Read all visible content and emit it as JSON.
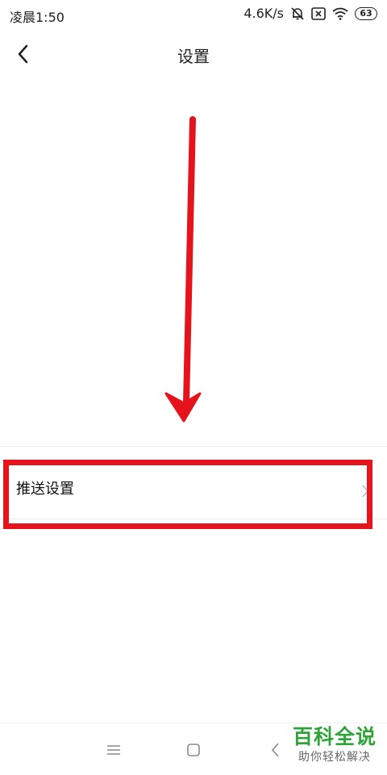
{
  "status_bar": {
    "time": "凌晨1:50",
    "speed": "4.6K/s",
    "battery": "63",
    "icons": [
      "bell-off-icon",
      "sim-x-icon",
      "wifi-icon",
      "battery-icon"
    ]
  },
  "header": {
    "title": "设置",
    "back_icon": "chevron-left-icon"
  },
  "settings": {
    "items": [
      {
        "label": "推送设置",
        "icon": "chevron-right-icon"
      }
    ]
  },
  "annotation": {
    "color": "#e5131b"
  },
  "nav": {
    "icons": [
      "menu-icon",
      "home-square-icon",
      "back-triangle-icon"
    ]
  },
  "watermark": {
    "main": "百科全说",
    "sub": "助你轻松解决",
    "color": "#2fa33a"
  }
}
